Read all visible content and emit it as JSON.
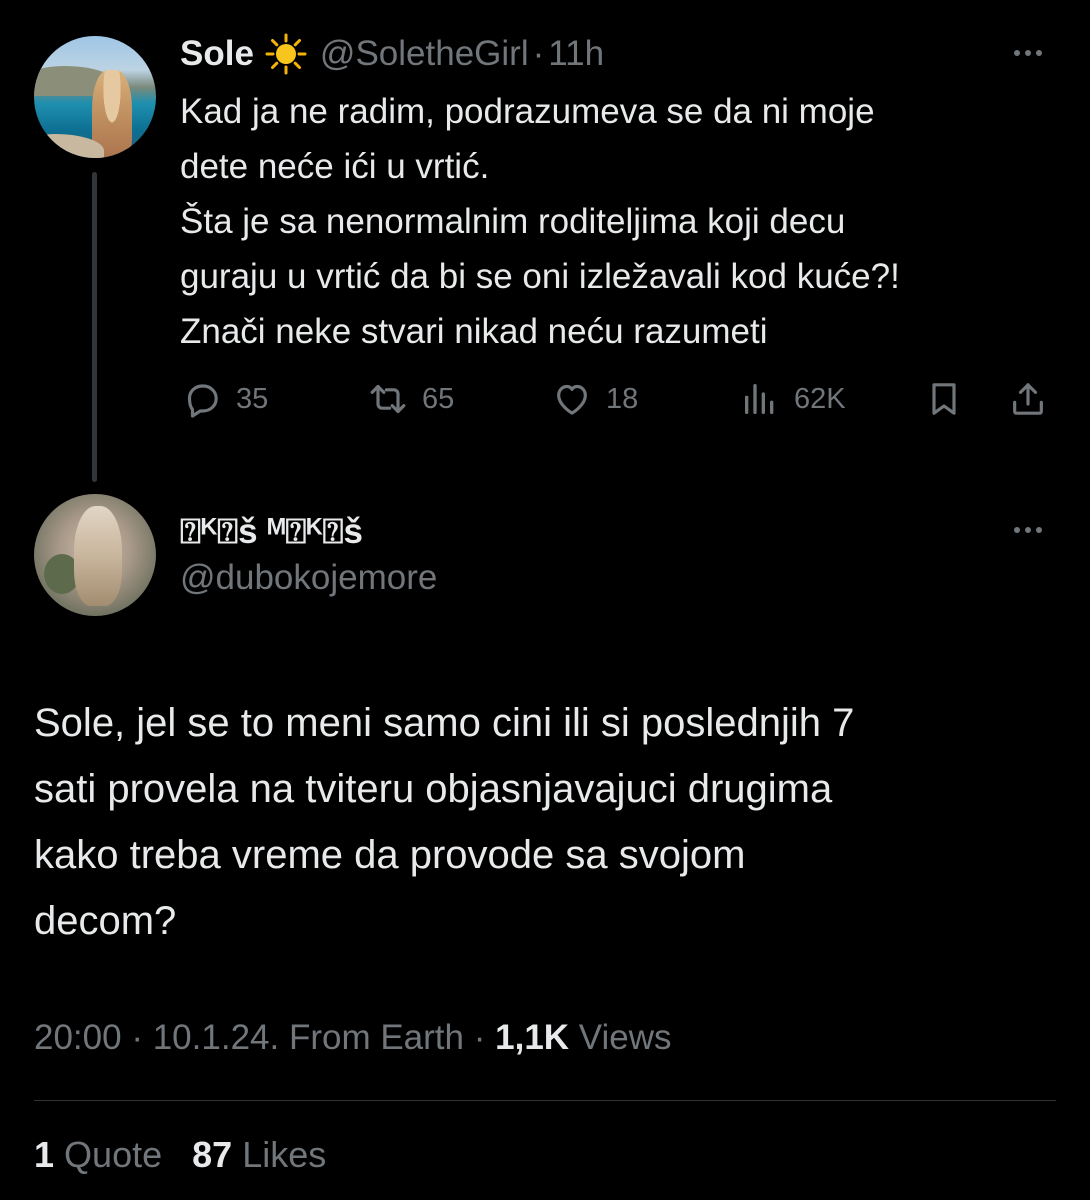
{
  "parent_tweet": {
    "display_name": "Sole",
    "emoji_icon": "sun-icon",
    "handle": "@SoletheGirl",
    "separator": "·",
    "time": "11h",
    "text_lines": [
      "Kad ja ne radim, podrazumeva se da ni moje",
      "dete neće ići u vrtić.",
      "Šta je sa nenormalnim roditeljima koji decu",
      "guraju u vrtić da bi se oni izležavali kod kuće?!",
      "Znači neke stvari nikad neću razumeti"
    ],
    "actions": {
      "replies": "35",
      "retweets": "65",
      "likes": "18",
      "views": "62K"
    }
  },
  "reply_tweet": {
    "display_name": "⍰ᴷ⍰š ᴹ⍰ᴷ⍰š",
    "handle": "@dubokojemore",
    "text_lines": [
      "Sole, jel se to meni samo cini ili si poslednjih 7",
      "sati provela na tviteru objasnjavajuci drugima",
      "kako treba vreme da provode sa svojom",
      "decom?"
    ],
    "meta": {
      "time": "20:00",
      "date": "10.1.24.",
      "location": "From Earth",
      "separator": "·",
      "views_count": "1,1K",
      "views_label": "Views"
    },
    "stats": {
      "quotes_count": "1",
      "quotes_label": "Quote",
      "likes_count": "87",
      "likes_label": "Likes"
    }
  },
  "colors": {
    "background": "#000000",
    "primary_text": "#e7e9ea",
    "secondary_text": "#71767b",
    "divider": "#2f3336"
  }
}
